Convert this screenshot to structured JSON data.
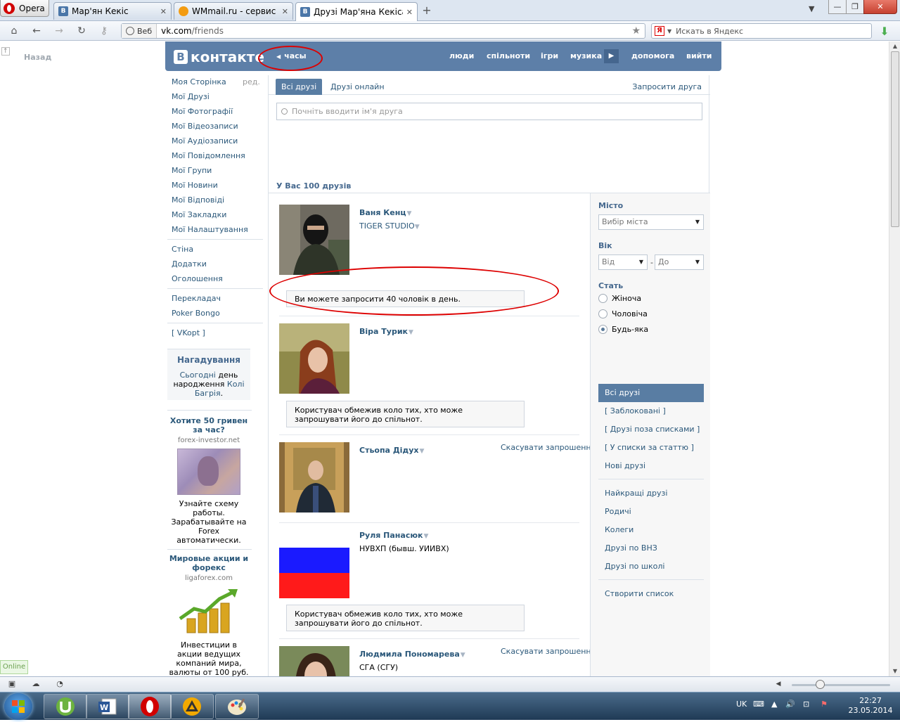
{
  "browser": {
    "menu_label": "Opera",
    "tabs": [
      {
        "title": "Мар'ян Кекіс",
        "active": false
      },
      {
        "title": "WMmail.ru - сервис п...",
        "active": false
      },
      {
        "title": "Друзі Мар'яна Кекіса |...",
        "active": true
      }
    ],
    "address": {
      "web_label": "Веб",
      "url_prefix": "vk.com",
      "url_path": "/friends"
    },
    "search_placeholder": "Искать в Яндекс"
  },
  "page": {
    "back_label": "Назад",
    "logo_text": "контакте",
    "logo_b": "В",
    "clock_label": "часы",
    "top_nav": [
      "люди",
      "спільноти",
      "ігри",
      "музика",
      "допомога",
      "вийти"
    ],
    "left_menu": [
      "Моя Сторінка",
      "Мої Друзі",
      "Мої Фотографії",
      "Мої Відеозаписи",
      "Мої Аудіозаписи",
      "Мої Повідомлення",
      "Мої Групи",
      "Мої Новини",
      "Мої Відповіді",
      "Мої Закладки",
      "Мої Налаштування"
    ],
    "edit_label": "ред.",
    "left_menu2": [
      "Стіна",
      "Додатки",
      "Оголошення"
    ],
    "left_menu3": [
      "Перекладач",
      "Poker Bongo"
    ],
    "vkopt": "[ VKopt ]",
    "reminder": {
      "title": "Нагадування",
      "today": "Сьогодні",
      "mid": " день народження ",
      "name": "Колі Багрія",
      "end": "."
    },
    "ads": [
      {
        "title": "Хотите 50 гривен за час?",
        "domain": "forex-investor.net",
        "text": "Узнайте схему работы. Зарабатывайте на Forex автоматически."
      },
      {
        "title": "Мировые акции и форекс",
        "domain": "ligaforex.com",
        "text": "Инвестиции в акции ведущих компаний мира, валюты от 100 руб."
      }
    ],
    "tabs": {
      "all": "Всі друзі",
      "online": "Друзі онлайн",
      "invite": "Запросити друга"
    },
    "search_placeholder": "Почніть вводити ім'я друга",
    "count_text": "У Вас 100 друзів",
    "filters": {
      "city_label": "Місто",
      "city_value": "Вибір міста",
      "age_label": "Вік",
      "age_from": "Від",
      "age_to": "До",
      "age_dash": "-",
      "sex_label": "Стать",
      "sex_options": [
        "Жіноча",
        "Чоловіча",
        "Будь-яка"
      ],
      "sex_selected": 2
    },
    "lists": {
      "selected": "Всі друзі",
      "group1": [
        "[ Заблоковані ]",
        "[ Друзі поза списками ]",
        "[ У списки за статтю ]",
        "Нові друзі"
      ],
      "group2": [
        "Найкращі друзі",
        "Родичі",
        "Колеги",
        "Друзі по ВНЗ",
        "Друзі по школі"
      ],
      "create": "Створити список"
    },
    "friends": [
      {
        "name": "Ваня Кенц",
        "sub": "TIGER STUDIO",
        "sub_is_link": true,
        "cancel": "",
        "note": "Ви можете запросити 40 чоловік в день."
      },
      {
        "name": "Віра Турик",
        "sub": "",
        "sub_is_link": false,
        "cancel": "",
        "note": "Користувач обмежив коло тих, хто може запрошувати його до спільнот."
      },
      {
        "name": "Стьопа Дідух",
        "sub": "",
        "sub_is_link": false,
        "cancel": "Скасувати запрошення",
        "note": ""
      },
      {
        "name": "Руля Панасюк",
        "sub": "НУВХП (бывш. УИИВХ)",
        "sub_is_link": false,
        "cancel": "",
        "note": "Користувач обмежив коло тих, хто може запрошувати його до спільнот."
      },
      {
        "name": "Людмила Пономарева",
        "sub": "СГА (СГУ)",
        "sub_is_link": false,
        "cancel": "Скасувати запрошення",
        "note": ""
      }
    ],
    "name_arrow": "▼"
  },
  "status": {
    "online_label": "Online"
  },
  "taskbar": {
    "lang": "UK",
    "time": "22:27",
    "date": "23.05.2014"
  },
  "colors": {
    "vk_blue": "#5d7fa8",
    "link": "#2b587a",
    "annotation_red": "#d00000"
  }
}
